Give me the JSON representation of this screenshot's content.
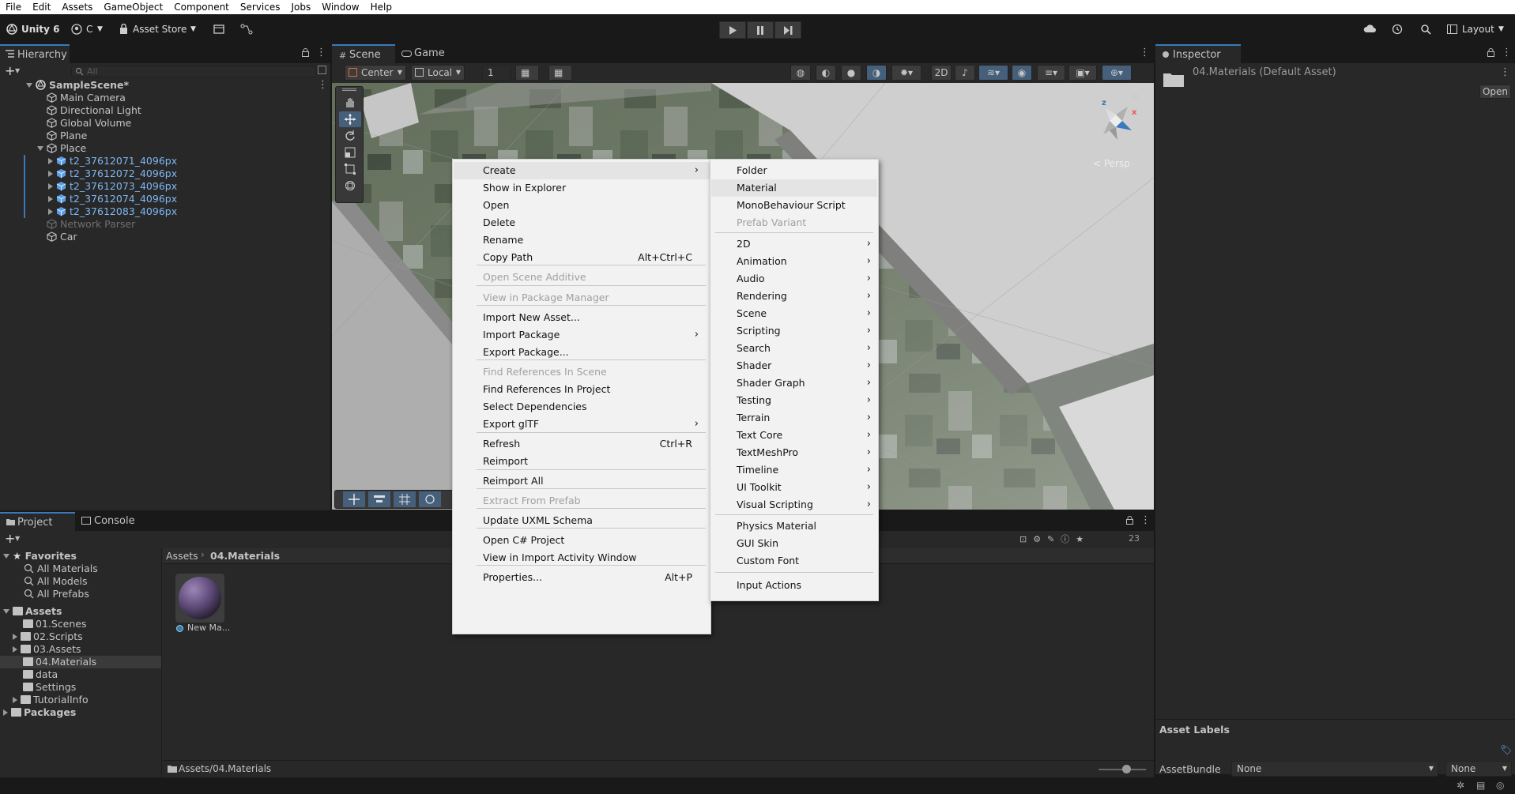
{
  "menubar": {
    "items": [
      "File",
      "Edit",
      "Assets",
      "GameObject",
      "Component",
      "Services",
      "Jobs",
      "Window",
      "Help"
    ]
  },
  "toolbar": {
    "unity_label": "Unity 6",
    "account_label": "C",
    "asset_store_label": "Asset Store",
    "layout_label": "Layout"
  },
  "hierarchy": {
    "tab_label": "Hierarchy",
    "search_placeholder": "All",
    "scene_name": "SampleScene*",
    "items": [
      {
        "label": "Main Camera"
      },
      {
        "label": "Directional Light"
      },
      {
        "label": "Global Volume"
      },
      {
        "label": "Plane"
      },
      {
        "label": "Place"
      },
      {
        "label": "t2_37612071_4096px"
      },
      {
        "label": "t2_37612072_4096px"
      },
      {
        "label": "t2_37612073_4096px"
      },
      {
        "label": "t2_37612074_4096px"
      },
      {
        "label": "t2_37612083_4096px"
      },
      {
        "label": "Network Parser"
      },
      {
        "label": "Car"
      }
    ]
  },
  "scene_view": {
    "tabs": [
      {
        "label": "Scene"
      },
      {
        "label": "Game"
      }
    ],
    "pivot_label": "Center",
    "space_label": "Local",
    "grid_value": "1",
    "persp_label": "< Persp",
    "gizmo_axes": {
      "x": "x",
      "z": "z"
    }
  },
  "inspector": {
    "tab_label": "Inspector",
    "asset_title": "04.Materials (Default Asset)",
    "open_label": "Open",
    "asset_labels": "Asset Labels",
    "assetbundle_label": "AssetBundle",
    "assetbundle_value": "None",
    "variant_value": "None"
  },
  "project": {
    "tabs": [
      {
        "label": "Project"
      },
      {
        "label": "Console"
      }
    ],
    "favorites_label": "Favorites",
    "favorites": [
      {
        "label": "All Materials"
      },
      {
        "label": "All Models"
      },
      {
        "label": "All Prefabs"
      }
    ],
    "assets_label": "Assets",
    "folders": [
      {
        "label": "01.Scenes"
      },
      {
        "label": "02.Scripts"
      },
      {
        "label": "03.Assets"
      },
      {
        "label": "04.Materials"
      },
      {
        "label": "data"
      },
      {
        "label": "Settings"
      },
      {
        "label": "TutorialInfo"
      }
    ],
    "packages_label": "Packages",
    "breadcrumb": {
      "root": "Assets",
      "current": "04.Materials"
    },
    "asset_item_label": "New Ma...",
    "footer_path": "Assets/04.Materials",
    "count_label": "23"
  },
  "context_menu": {
    "items": [
      {
        "label": "Create"
      },
      {
        "label": "Show in Explorer"
      },
      {
        "label": "Open"
      },
      {
        "label": "Delete"
      },
      {
        "label": "Rename"
      },
      {
        "label": "Copy Path",
        "shortcut": "Alt+Ctrl+C"
      },
      {
        "label": "Open Scene Additive"
      },
      {
        "label": "View in Package Manager"
      },
      {
        "label": "Import New Asset..."
      },
      {
        "label": "Import Package"
      },
      {
        "label": "Export Package..."
      },
      {
        "label": "Find References In Scene"
      },
      {
        "label": "Find References In Project"
      },
      {
        "label": "Select Dependencies"
      },
      {
        "label": "Export glTF"
      },
      {
        "label": "Refresh",
        "shortcut": "Ctrl+R"
      },
      {
        "label": "Reimport"
      },
      {
        "label": "Reimport All"
      },
      {
        "label": "Extract From Prefab"
      },
      {
        "label": "Update UXML Schema"
      },
      {
        "label": "Open C# Project"
      },
      {
        "label": "View in Import Activity Window"
      },
      {
        "label": "Properties...",
        "shortcut": "Alt+P"
      }
    ]
  },
  "create_submenu": {
    "items": [
      {
        "label": "Folder"
      },
      {
        "label": "Material"
      },
      {
        "label": "MonoBehaviour Script"
      },
      {
        "label": "Prefab Variant"
      },
      {
        "label": "2D"
      },
      {
        "label": "Animation"
      },
      {
        "label": "Audio"
      },
      {
        "label": "Rendering"
      },
      {
        "label": "Scene"
      },
      {
        "label": "Scripting"
      },
      {
        "label": "Search"
      },
      {
        "label": "Shader"
      },
      {
        "label": "Shader Graph"
      },
      {
        "label": "Testing"
      },
      {
        "label": "Terrain"
      },
      {
        "label": "Text Core"
      },
      {
        "label": "TextMeshPro"
      },
      {
        "label": "Timeline"
      },
      {
        "label": "UI Toolkit"
      },
      {
        "label": "Visual Scripting"
      },
      {
        "label": "Physics Material"
      },
      {
        "label": "GUI Skin"
      },
      {
        "label": "Custom Font"
      },
      {
        "label": "Input Actions"
      }
    ]
  },
  "colors": {
    "accent": "#3a79bb",
    "prefab_blue": "#7fb6f2",
    "panel": "#282828",
    "toolbar": "#191919",
    "menu_bg": "#f2f2f2"
  }
}
